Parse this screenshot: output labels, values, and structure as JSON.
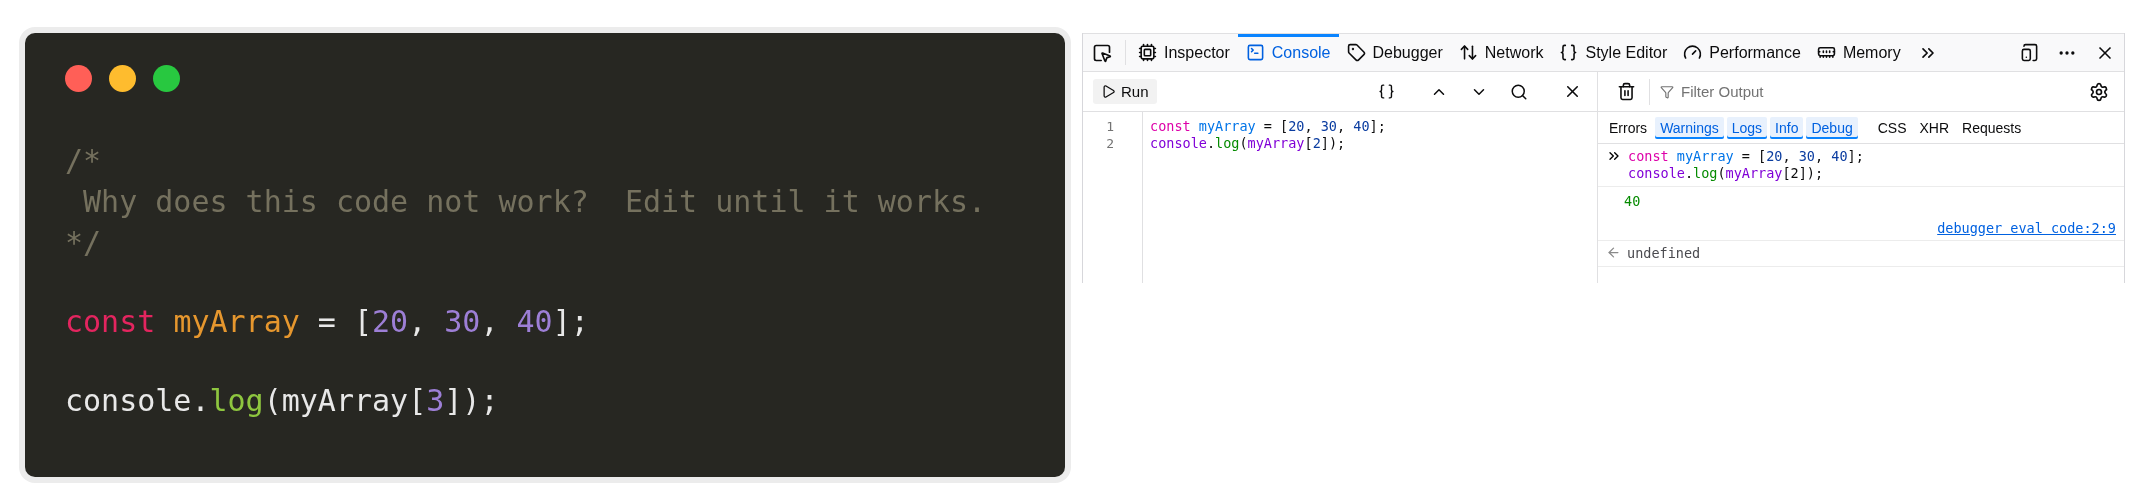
{
  "code_card": {
    "window_dots": [
      {
        "color": "#ff5f57"
      },
      {
        "color": "#febc2e"
      },
      {
        "color": "#28c840"
      }
    ],
    "blocks": [
      {
        "lines": [
          [
            {
              "text": "/*",
              "kind": "comment"
            }
          ],
          [
            {
              "text": " Why does this code not work?  Edit until it works.",
              "kind": "comment"
            }
          ],
          [
            {
              "text": "*/",
              "kind": "comment"
            }
          ]
        ]
      },
      {
        "lines": [
          [
            {
              "text": "const ",
              "kind": "keyword"
            },
            {
              "text": "myArray",
              "kind": "variable"
            },
            {
              "text": " = [",
              "kind": "plain"
            },
            {
              "text": "20",
              "kind": "number"
            },
            {
              "text": ", ",
              "kind": "plain"
            },
            {
              "text": "30",
              "kind": "number"
            },
            {
              "text": ", ",
              "kind": "plain"
            },
            {
              "text": "40",
              "kind": "number"
            },
            {
              "text": "];",
              "kind": "plain"
            }
          ]
        ]
      },
      {
        "lines": [
          [
            {
              "text": "console.",
              "kind": "plain"
            },
            {
              "text": "log",
              "kind": "function"
            },
            {
              "text": "(myArray[",
              "kind": "plain"
            },
            {
              "text": "3",
              "kind": "number"
            },
            {
              "text": "]);",
              "kind": "plain"
            }
          ]
        ]
      }
    ]
  },
  "devtools": {
    "tabs": [
      {
        "label": "Inspector",
        "selected": false
      },
      {
        "label": "Console",
        "selected": true
      },
      {
        "label": "Debugger",
        "selected": false
      },
      {
        "label": "Network",
        "selected": false
      },
      {
        "label": "Style Editor",
        "selected": false
      },
      {
        "label": "Performance",
        "selected": false
      },
      {
        "label": "Memory",
        "selected": false
      }
    ],
    "editor": {
      "run_button": "Run",
      "lines": [
        {
          "number": "1",
          "tokens": [
            {
              "text": "const ",
              "kind": "keyword"
            },
            {
              "text": "myArray",
              "kind": "variable"
            },
            {
              "text": " = [",
              "kind": "plain"
            },
            {
              "text": "20",
              "kind": "number"
            },
            {
              "text": ", ",
              "kind": "plain"
            },
            {
              "text": "30",
              "kind": "number"
            },
            {
              "text": ", ",
              "kind": "plain"
            },
            {
              "text": "40",
              "kind": "number"
            },
            {
              "text": "];",
              "kind": "plain"
            }
          ]
        },
        {
          "number": "2",
          "tokens": [
            {
              "text": "console",
              "kind": "object"
            },
            {
              "text": ".",
              "kind": "plain"
            },
            {
              "text": "log",
              "kind": "function"
            },
            {
              "text": "(",
              "kind": "plain"
            },
            {
              "text": "myArray",
              "kind": "object"
            },
            {
              "text": "[",
              "kind": "plain"
            },
            {
              "text": "2",
              "kind": "number"
            },
            {
              "text": "]);",
              "kind": "plain"
            }
          ]
        }
      ]
    },
    "console": {
      "filter_placeholder": "Filter Output",
      "level_filters": [
        {
          "label": "Errors",
          "selected": false
        },
        {
          "label": "Warnings",
          "selected": true
        },
        {
          "label": "Logs",
          "selected": true
        },
        {
          "label": "Info",
          "selected": true
        },
        {
          "label": "Debug",
          "selected": true
        }
      ],
      "request_filters": [
        {
          "label": "CSS",
          "selected": false
        },
        {
          "label": "XHR",
          "selected": false
        },
        {
          "label": "Requests",
          "selected": false
        }
      ],
      "messages": [
        {
          "kind": "input",
          "lines": [
            [
              {
                "text": "const ",
                "kind": "keyword"
              },
              {
                "text": "myArray",
                "kind": "variable"
              },
              {
                "text": " = [",
                "kind": "plain"
              },
              {
                "text": "20",
                "kind": "number"
              },
              {
                "text": ", ",
                "kind": "plain"
              },
              {
                "text": "30",
                "kind": "number"
              },
              {
                "text": ", ",
                "kind": "plain"
              },
              {
                "text": "40",
                "kind": "number"
              },
              {
                "text": "];",
                "kind": "plain"
              }
            ],
            [
              {
                "text": "console",
                "kind": "object"
              },
              {
                "text": ".",
                "kind": "plain"
              },
              {
                "text": "log",
                "kind": "function"
              },
              {
                "text": "(",
                "kind": "plain"
              },
              {
                "text": "myArray",
                "kind": "object"
              },
              {
                "text": "[2]);",
                "kind": "plain"
              }
            ]
          ]
        },
        {
          "kind": "log",
          "text": "40",
          "source": "debugger eval code:2:9"
        },
        {
          "kind": "result",
          "text": "undefined"
        }
      ]
    }
  }
}
